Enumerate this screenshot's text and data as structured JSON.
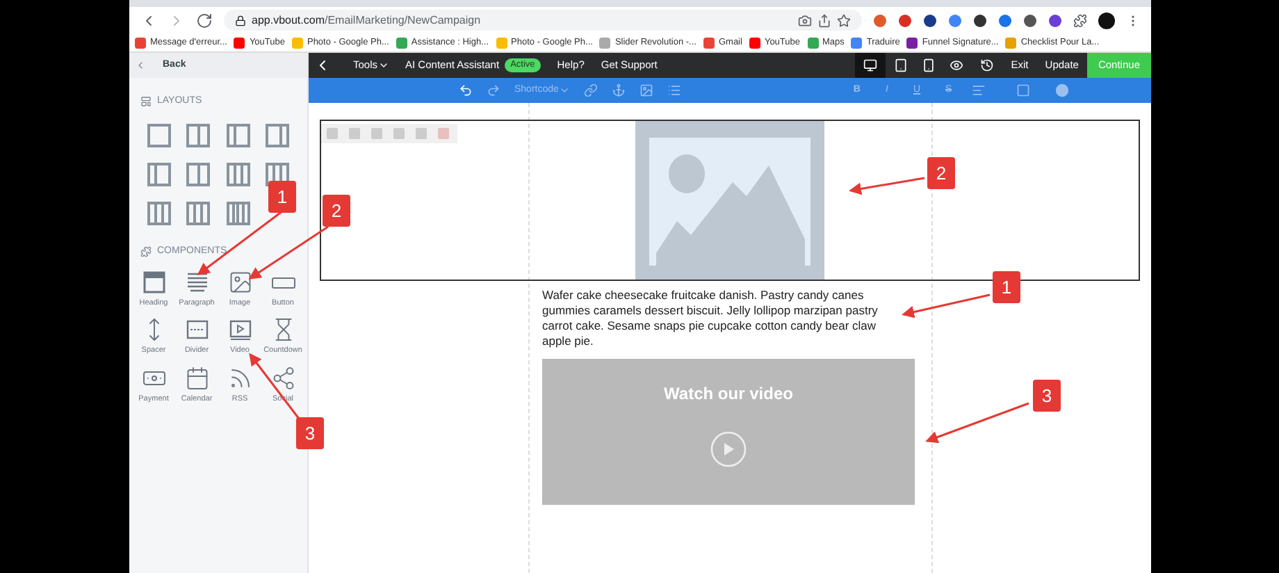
{
  "browser": {
    "url_host": "app.vbout.com",
    "url_path": "/EmailMarketing/NewCampaign",
    "bookmarks": [
      "Message d'erreur...",
      "YouTube",
      "Photo - Google Ph...",
      "Assistance : High...",
      "Photo - Google Ph...",
      "Slider Revolution -...",
      "Gmail",
      "YouTube",
      "Maps",
      "Traduire",
      "Funnel Signature...",
      "Checklist Pour La..."
    ]
  },
  "sidebar": {
    "back": "Back",
    "layouts_title": "LAYOUTS",
    "components_title": "COMPONENTS",
    "components": [
      {
        "kind": "heading",
        "label": "Heading"
      },
      {
        "kind": "paragraph",
        "label": "Paragraph"
      },
      {
        "kind": "image",
        "label": "Image"
      },
      {
        "kind": "button",
        "label": "Button"
      },
      {
        "kind": "spacer",
        "label": "Spacer"
      },
      {
        "kind": "divider",
        "label": "Divider"
      },
      {
        "kind": "video",
        "label": "Video"
      },
      {
        "kind": "countdown",
        "label": "Countdown"
      },
      {
        "kind": "payment",
        "label": "Payment"
      },
      {
        "kind": "calendar",
        "label": "Calendar"
      },
      {
        "kind": "rss",
        "label": "RSS"
      },
      {
        "kind": "social",
        "label": "Social"
      }
    ]
  },
  "topbar": {
    "tools": "Tools",
    "assistant": "AI Content Assistant",
    "assistant_badge": "Active",
    "help": "Help?",
    "support": "Get Support",
    "exit": "Exit",
    "update": "Update",
    "continue": "Continue"
  },
  "format_toolbar": {
    "shortcode": "Shortcode",
    "styles": [
      "B",
      "I",
      "U",
      "S"
    ]
  },
  "canvas": {
    "paragraph": "Wafer cake cheesecake fruitcake danish. Pastry candy canes gummies caramels dessert biscuit. Jelly lollipop marzipan pastry carrot cake. Sesame snaps pie cupcake cotton candy bear claw apple pie.",
    "video_title": "Watch our video"
  },
  "annotations": [
    {
      "label": "1"
    },
    {
      "label": "2"
    },
    {
      "label": "2"
    },
    {
      "label": "1"
    },
    {
      "label": "3"
    },
    {
      "label": "3"
    }
  ]
}
